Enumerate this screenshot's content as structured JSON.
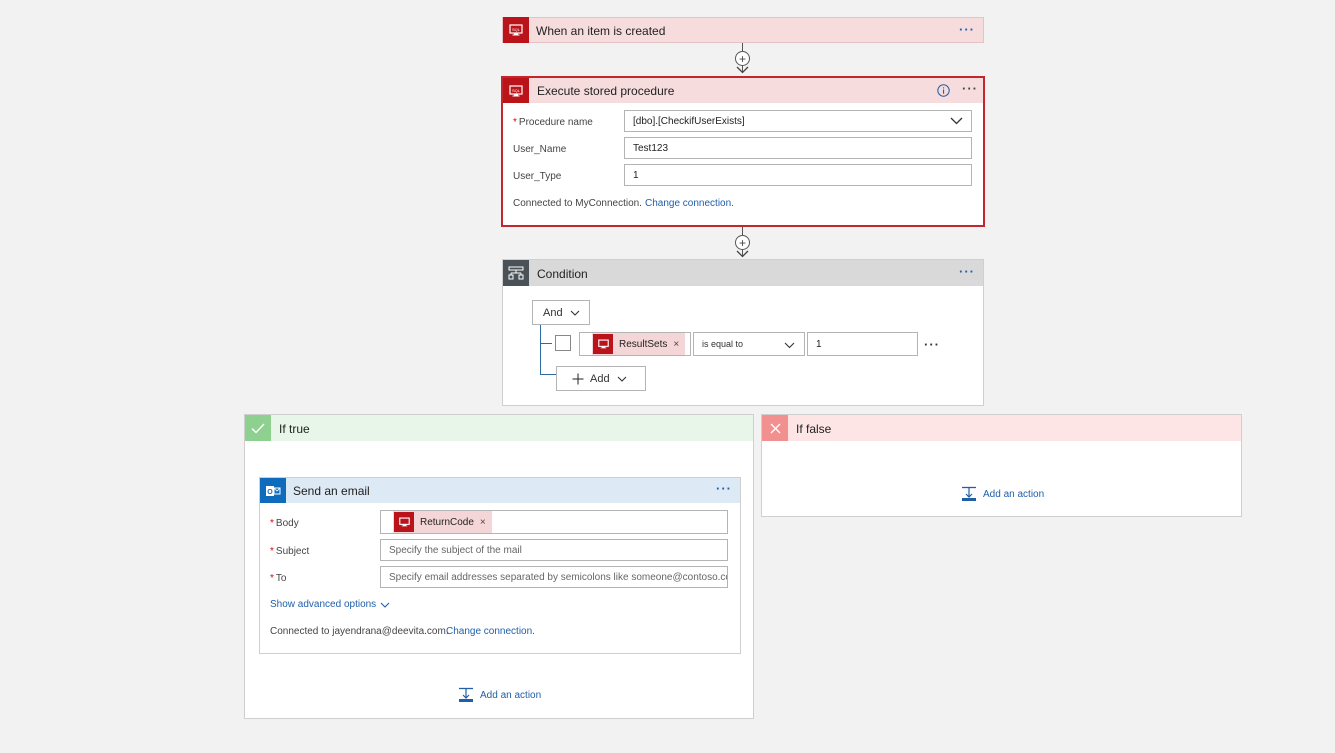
{
  "trigger": {
    "title": "When an item is created",
    "icon": "sql-icon"
  },
  "stored_procedure": {
    "title": "Execute stored procedure",
    "fields": [
      {
        "label": "Procedure name",
        "required": true,
        "value": "[dbo].[CheckifUserExists]"
      },
      {
        "label": "User_Name",
        "required": false,
        "value": "Test123"
      },
      {
        "label": "User_Type",
        "required": false,
        "value": "1"
      }
    ],
    "connection_text": "Connected to MyConnection.",
    "change_connection": "Change connection."
  },
  "condition": {
    "title": "Condition",
    "group_operator": "And",
    "row": {
      "token": "ResultSets",
      "operator": "is equal to",
      "value": "1"
    },
    "add_label": "Add"
  },
  "if_true": {
    "title": "If true",
    "email": {
      "title": "Send an email",
      "fields": [
        {
          "label": "Body",
          "required": true,
          "token": "ReturnCode"
        },
        {
          "label": "Subject",
          "required": true,
          "placeholder": "Specify the subject of the mail"
        },
        {
          "label": "To",
          "required": true,
          "placeholder": "Specify email addresses separated by semicolons like someone@contoso.com"
        }
      ],
      "show_advanced": "Show advanced options",
      "connection_text": "Connected to jayendrana@deevita.com.",
      "change_connection": "Change connection."
    },
    "add_action": "Add an action"
  },
  "if_false": {
    "title": "If false",
    "add_action": "Add an action"
  },
  "symbols": {
    "ellipsis": "···",
    "plus": "+",
    "close": "×",
    "required": "*"
  },
  "colors": {
    "sql_red": "#ba141a",
    "error_header": "#f6dcdd",
    "error_border": "#c4262e",
    "condition_header": "#d9d9d9",
    "true_header": "#e7f6e8",
    "true_icon": "#8ed08f",
    "false_header": "#fde5e5",
    "false_icon": "#f1908f",
    "email_header": "#dde9f5",
    "outlook_blue": "#0f6cbd",
    "link": "#1f5fa8"
  }
}
